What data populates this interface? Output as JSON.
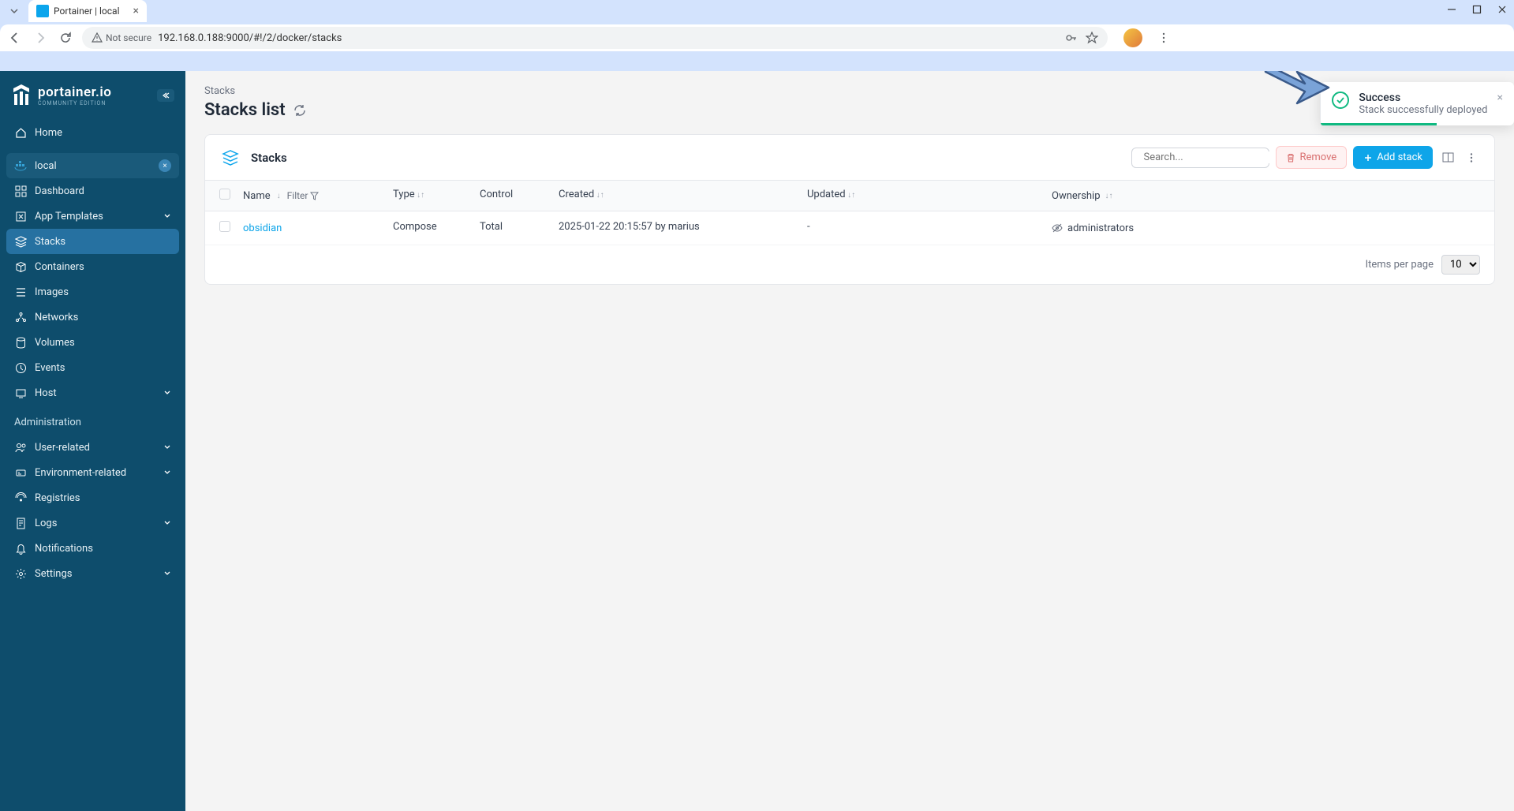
{
  "browser": {
    "tab_title": "Portainer | local",
    "url": "192.168.0.188:9000/#!/2/docker/stacks",
    "security_label": "Not secure"
  },
  "sidebar": {
    "logo_main": "portainer.io",
    "logo_sub": "COMMUNITY EDITION",
    "home": "Home",
    "env_name": "local",
    "items": {
      "dashboard": "Dashboard",
      "templates": "App Templates",
      "stacks": "Stacks",
      "containers": "Containers",
      "images": "Images",
      "networks": "Networks",
      "volumes": "Volumes",
      "events": "Events",
      "host": "Host"
    },
    "admin_label": "Administration",
    "admin": {
      "user": "User-related",
      "env": "Environment-related",
      "registries": "Registries",
      "logs": "Logs",
      "notifications": "Notifications",
      "settings": "Settings"
    }
  },
  "page": {
    "breadcrumb": "Stacks",
    "title": "Stacks list"
  },
  "panel": {
    "title": "Stacks",
    "search_placeholder": "Search...",
    "remove_label": "Remove",
    "add_label": "Add stack"
  },
  "table": {
    "headers": {
      "name": "Name",
      "filter": "Filter",
      "type": "Type",
      "control": "Control",
      "created": "Created",
      "updated": "Updated",
      "ownership": "Ownership"
    },
    "rows": [
      {
        "name": "obsidian",
        "type": "Compose",
        "control": "Total",
        "created": "2025-01-22 20:15:57 by marius",
        "updated": "-",
        "ownership": "administrators"
      }
    ],
    "footer": {
      "label": "Items per page",
      "value": "10"
    }
  },
  "toast": {
    "title": "Success",
    "message": "Stack successfully deployed"
  }
}
